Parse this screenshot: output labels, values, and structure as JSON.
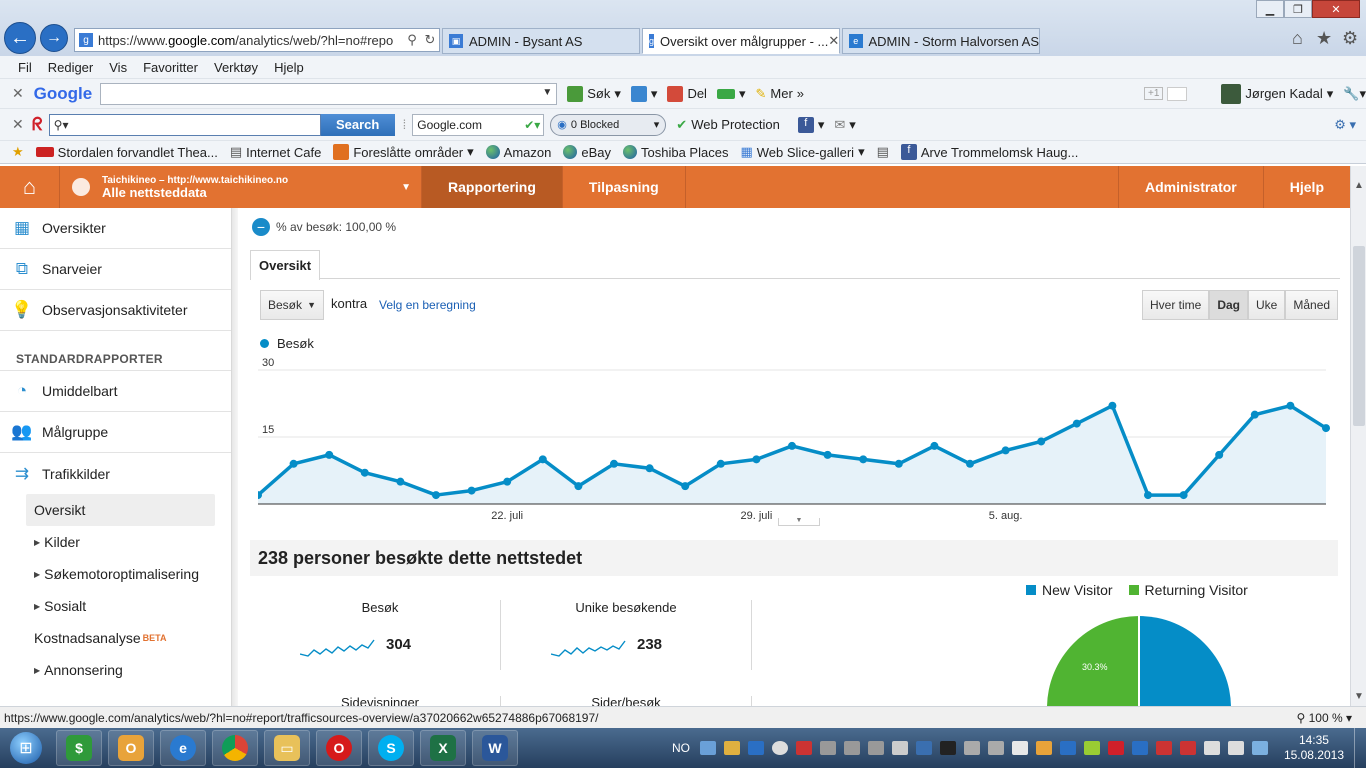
{
  "browser": {
    "address_url_prefix": "https://www.",
    "address_url_domain": "google.com",
    "address_url_rest": "/analytics/web/?hl=no#repo",
    "tabs": [
      {
        "label": "ADMIN - Bysant AS"
      },
      {
        "label": "Oversikt over målgrupper - ..."
      },
      {
        "label": "ADMIN - Storm Halvorsen AS"
      }
    ],
    "menu": [
      "Fil",
      "Rediger",
      "Vis",
      "Favoritter",
      "Verktøy",
      "Hjelp"
    ]
  },
  "google_toolbar": {
    "brand": "Google",
    "search_label": "Søk",
    "share_label": "Del",
    "more_label": "Mer",
    "gplus": "+1",
    "user": "Jørgen Kadal"
  },
  "avg_toolbar": {
    "search_button": "Search",
    "engine": "Google.com",
    "blocked": "0 Blocked",
    "web_protection": "Web Protection"
  },
  "favorites": [
    "Stordalen forvandlet Thea...",
    "Internet Cafe",
    "Foreslåtte områder",
    "Amazon",
    "eBay",
    "Toshiba Places",
    "Web Slice-galleri",
    "Arve Trommelomsk Haug..."
  ],
  "ga_header": {
    "site_line1": "Taichikineo – http://www.taichikineo.no",
    "site_line2": "Alle nettsteddata",
    "nav": [
      "Rapportering",
      "Tilpasning"
    ],
    "right": [
      "Administrator",
      "Hjelp"
    ]
  },
  "sidebar": {
    "top_items": [
      "Oversikter",
      "Snarveier",
      "Observasjonsaktiviteter"
    ],
    "section_title": "STANDARDRAPPORTER",
    "main_items": [
      "Umiddelbart",
      "Målgruppe",
      "Trafikkilder"
    ],
    "sub_items": [
      "Oversikt",
      "Kilder",
      "Søkemotoroptimalisering",
      "Sosialt"
    ],
    "cost_label": "Kostnadsanalyse",
    "beta": "BETA",
    "ads_label": "Annonsering"
  },
  "main": {
    "segment_text": "% av besøk: 100,00 %",
    "tab_label": "Oversikt",
    "metric_select": "Besøk",
    "versus": "kontra",
    "pick_metric": "Velg en beregning",
    "granularity": [
      "Hver time",
      "Dag",
      "Uke",
      "Måned"
    ],
    "granularity_selected": "Dag",
    "summary_title": "238 personer besøkte dette nettstedet",
    "metrics": [
      {
        "label": "Besøk",
        "value": "304"
      },
      {
        "label": "Unike besøkende",
        "value": "238"
      }
    ],
    "metrics_row2": [
      "Sidevisninger",
      "Sider/besøk"
    ],
    "pie_legend": [
      "New Visitor",
      "Returning Visitor"
    ],
    "pie_label": "30.3%",
    "colors": {
      "line": "#058dc7",
      "new": "#058dc7",
      "returning": "#50b432"
    }
  },
  "chart_data": {
    "type": "area",
    "series": [
      {
        "name": "Besøk",
        "values": [
          2,
          9,
          11,
          7,
          5,
          2,
          3,
          5,
          10,
          4,
          9,
          8,
          4,
          9,
          10,
          13,
          11,
          10,
          9,
          13,
          9,
          12,
          14,
          18,
          22,
          2,
          2,
          11,
          20,
          22,
          17
        ]
      }
    ],
    "y_ticks": [
      "30",
      "15"
    ],
    "ylim": [
      0,
      30
    ],
    "x_tick_labels": [
      "22. juli",
      "29. juli",
      "5. aug."
    ],
    "x_tick_indices": [
      7,
      14,
      21
    ]
  },
  "statusbar": {
    "url": "https://www.google.com/analytics/web/?hl=no#report/trafficsources-overview/a37020662w65274886p67068197/",
    "zoom": "100 %"
  },
  "taskbar": {
    "lang": "NO",
    "time": "14:35",
    "date": "15.08.2013"
  }
}
